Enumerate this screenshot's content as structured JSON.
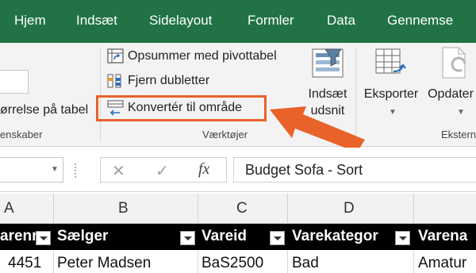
{
  "tabs": [
    "Hjem",
    "Indsæt",
    "Sidelayout",
    "Formler",
    "Data",
    "Gennemse"
  ],
  "ribbon": {
    "left_group": {
      "text": "ørrelse på tabel",
      "label": "enskaber"
    },
    "tools": {
      "summarize_pivot": "Opsummer med pivottabel",
      "remove_duplicates": "Fjern dubletter",
      "convert_to_range": "Konvertér til område",
      "label": "Værktøjer"
    },
    "insert_slicer": {
      "line1": "Indsæt",
      "line2": "udsnit"
    },
    "export": "Eksporter",
    "refresh": "Opdater",
    "external_label": "Ekstern",
    "highlight_color": "#e8622a"
  },
  "formula_bar": {
    "cancel_symbol": "✕",
    "enter_symbol": "✓",
    "fx_symbol": "fx",
    "value": "Budget Sofa - Sort"
  },
  "columns": [
    "A",
    "B",
    "C",
    "D"
  ],
  "table": {
    "headers": [
      "arenr",
      "Sælger",
      "Vareid",
      "Varekategor",
      "Varena"
    ],
    "rows": [
      [
        "4451",
        "Peter Madsen",
        "BaS2500",
        "Bad",
        "Amatur"
      ]
    ]
  },
  "colors": {
    "tab_bar": "#217346",
    "header_row": "#000000",
    "arrow": "#e8622a"
  }
}
